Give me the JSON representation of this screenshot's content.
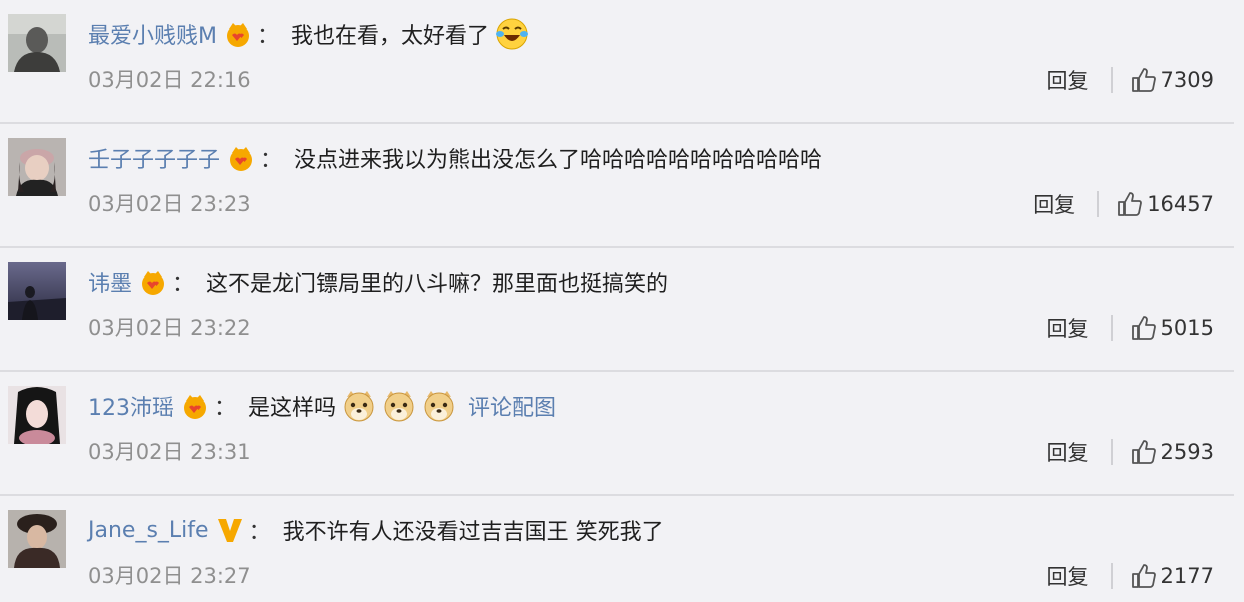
{
  "comments": [
    {
      "username": "最爱小贱贱M",
      "badge": "crown-icon",
      "colon": "：",
      "text": "我也在看，太好看了",
      "emoji": [
        "laughing-tears-icon"
      ],
      "link": "",
      "time": "03月02日 22:16",
      "reply": "回复",
      "likes": "7309"
    },
    {
      "username": "壬子子子子子",
      "badge": "crown-icon",
      "colon": "：",
      "text": "没点进来我以为熊出没怎么了哈哈哈哈哈哈哈哈哈哈哈",
      "emoji": [],
      "link": "",
      "time": "03月02日 23:23",
      "reply": "回复",
      "likes": "16457"
    },
    {
      "username": "讳墨",
      "badge": "crown-icon",
      "colon": "：",
      "text": "这不是龙门镖局里的八斗嘛？那里面也挺搞笑的",
      "emoji": [],
      "link": "",
      "time": "03月02日 23:22",
      "reply": "回复",
      "likes": "5015"
    },
    {
      "username": "123沛瑶",
      "badge": "crown-icon",
      "colon": "：",
      "text": "是这样吗",
      "emoji": [
        "doge-icon",
        "doge-icon",
        "doge-icon"
      ],
      "link": "评论配图",
      "time": "03月02日 23:31",
      "reply": "回复",
      "likes": "2593"
    },
    {
      "username": "Jane_s_Life",
      "badge": "verified-v-icon",
      "colon": "：",
      "text": "我不许有人还没看过吉吉国王 笑死我了",
      "emoji": [],
      "link": "",
      "time": "03月02日 23:27",
      "reply": "回复",
      "likes": "2177"
    }
  ],
  "colors": {
    "background": "#f2f2f5",
    "username": "#5b7fb0",
    "text": "#1f1f1f",
    "muted": "#8f8f8f",
    "badge": "#f6a800"
  }
}
